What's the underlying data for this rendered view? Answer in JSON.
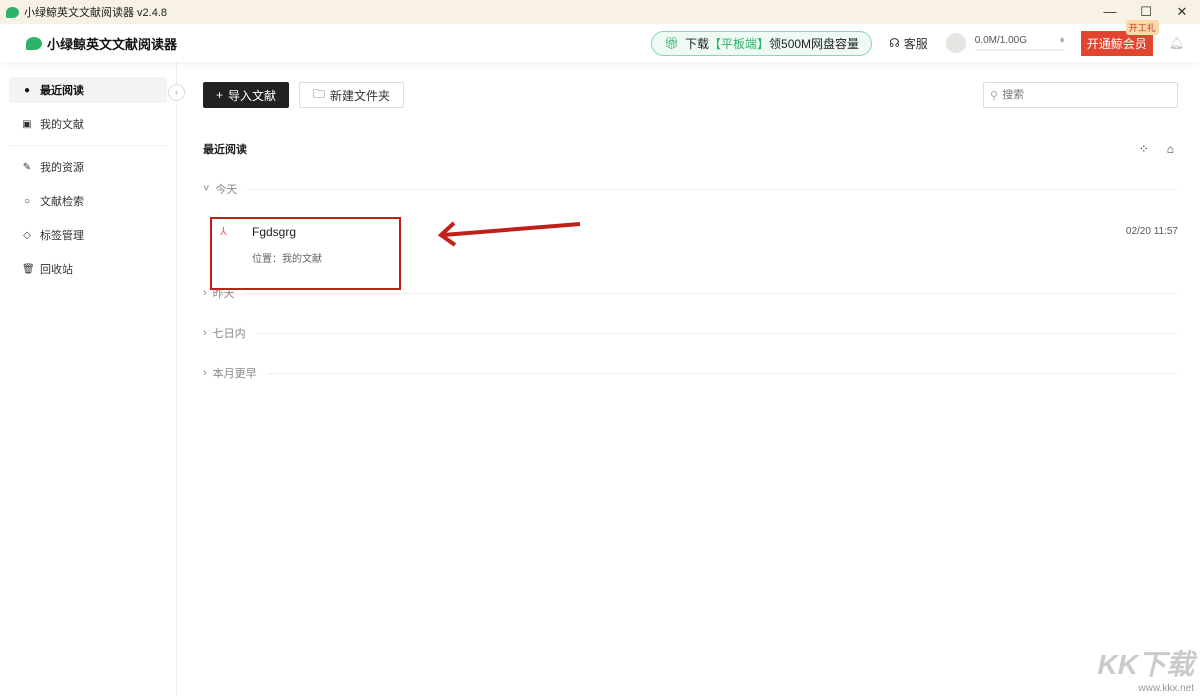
{
  "window": {
    "title": "小绿鲸英文文献阅读器 v2.4.8",
    "minimize": "—",
    "maximize": "☐",
    "close": "✕"
  },
  "header": {
    "brand": "小绿鲸英文文献阅读器",
    "promo_prefix": "下载",
    "promo_highlight": "【平板端】",
    "promo_suffix": "领500M网盘容量",
    "service": "客服",
    "storage": "0.0M/1.00G",
    "vip_button": "开通鲸会员",
    "vip_tag": "开工礼"
  },
  "sidebar": {
    "items": [
      {
        "label": "最近阅读",
        "icon": "clock-icon",
        "active": true
      },
      {
        "label": "我的文献",
        "icon": "document-icon"
      },
      {
        "label": "我的资源",
        "icon": "feather-icon"
      },
      {
        "label": "文献检索",
        "icon": "search-icon"
      },
      {
        "label": "标签管理",
        "icon": "tag-icon"
      },
      {
        "label": "回收站",
        "icon": "trash-icon"
      }
    ]
  },
  "toolbar": {
    "import": "导入文献",
    "new_folder": "新建文件夹",
    "search_placeholder": "搜索"
  },
  "main": {
    "title": "最近阅读",
    "groups": [
      {
        "label": "今天",
        "expanded": true,
        "docs": [
          {
            "name": "Fgdsgrg",
            "location": "位置：我的文献",
            "time": "02/20 11:57"
          }
        ]
      },
      {
        "label": "昨天"
      },
      {
        "label": "七日内"
      },
      {
        "label": "本月更早"
      }
    ]
  },
  "watermark": {
    "logo": "KK下载",
    "url": "www.kkx.net"
  },
  "colors": {
    "accent_green": "#2fb36b",
    "vip_red": "#e2452f",
    "annotation_red": "#c0201a"
  }
}
